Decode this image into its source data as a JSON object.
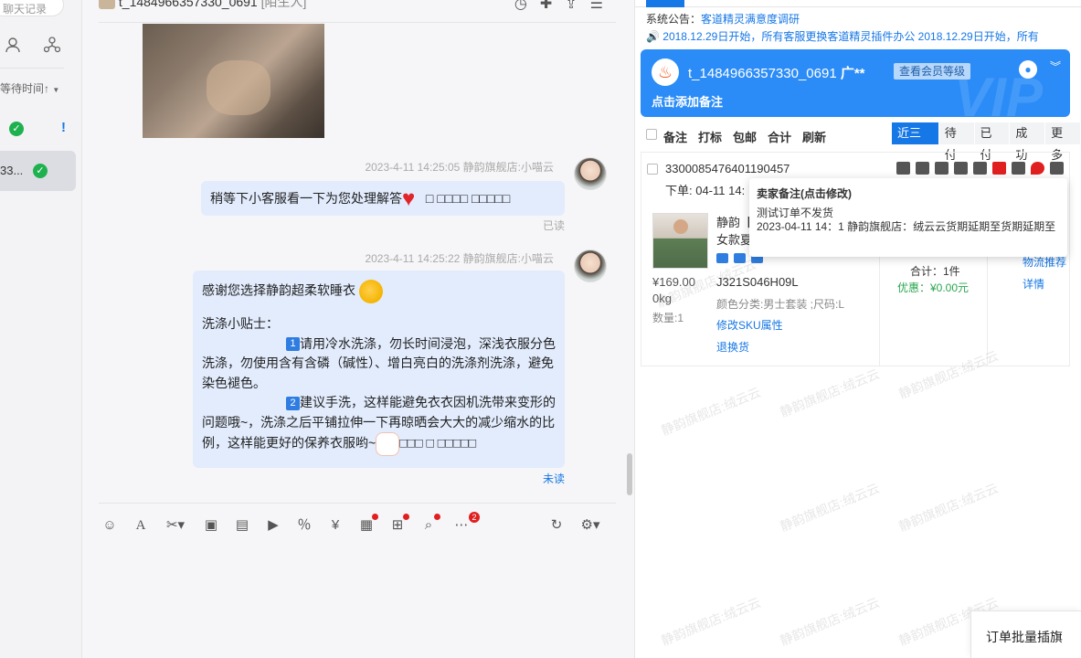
{
  "left_panel": {
    "search_placeholder": "聊天记录",
    "sort_label": "等待时间↑",
    "contact_short": "33..."
  },
  "chat": {
    "title": "t_1484966357330_0691",
    "title_tag": "[陌生人]",
    "messages": [
      {
        "time": "2023-4-11 14:25:05",
        "sender": "静韵旗舰店:小喵云",
        "text": "稍等下小客服看一下为您处理解答",
        "tail": "  □ □□□□    □□□□□",
        "status": "已读"
      },
      {
        "time": "2023-4-11 14:25:22",
        "sender": "静韵旗舰店:小喵云",
        "status": "未读",
        "lines": [
          "感谢您选择静韵超柔软睡衣",
          "洗涤小贴士：",
          "请用冷水洗涤，勿长时间浸泡，深浅衣服分色洗涤，勿使用含有含磷（碱性）、增白亮白的洗涤剂洗涤，避免染色褪色。",
          "建议手洗，这样能避免衣衣因机洗带来变形的问题哦~，洗涤之后平铺拉伸一下再晾晒会大大的减少缩水的比例，这样能更好的保养衣服哟~",
          "□□□  □ □□□□□"
        ],
        "num1": "1",
        "num2": "2"
      }
    ],
    "toolbar_badge": "2"
  },
  "right_panel": {
    "notice_label": "系统公告：",
    "notice_link": "客道精灵满意度调研",
    "notice_scroll": "🔊 2018.12.29日开始，所有客服更换客道精灵插件办公   2018.12.29日开始，所有",
    "customer": {
      "name": "t_1484966357330_0691",
      "region": "广**",
      "level_button": "查看会员等级",
      "remark": "点击添加备注",
      "watermark": "VIP"
    },
    "actions": [
      "备注",
      "打标",
      "包邮",
      "合计",
      "刷新"
    ],
    "filters": [
      "近三月",
      "待付",
      "已付",
      "成功",
      "更多"
    ],
    "order": {
      "id": "3300085476401190457",
      "time": "下单: 04-11 14:",
      "product_title": "静韵【",
      "product_sub": "女款夏",
      "price": "¥169.00",
      "weight": "0kg",
      "quantity": "数量:1",
      "sku": "J321S046H09L",
      "sku_attr": "颜色分类:男士套装 ;尺码:L",
      "modify_sku": "修改SKU属性",
      "refund": "退换货",
      "logistics": "物流推荐",
      "details": "详情",
      "total": "合计：1件",
      "discount": "优惠：¥0.00元"
    },
    "tooltip": {
      "title": "卖家备注(点击修改)",
      "line1": "测试订单不发货",
      "line2": "2023-04-11 14：1 静韵旗舰店：绒云云货期延期至货期延期至"
    },
    "watermark_text": "静韵旗舰店:绒云云",
    "batch_button": "订单批量插旗"
  },
  "colors": {
    "accent": "#1677e6",
    "card": "#2b8cf7",
    "bubble": "#e2ecfd"
  }
}
